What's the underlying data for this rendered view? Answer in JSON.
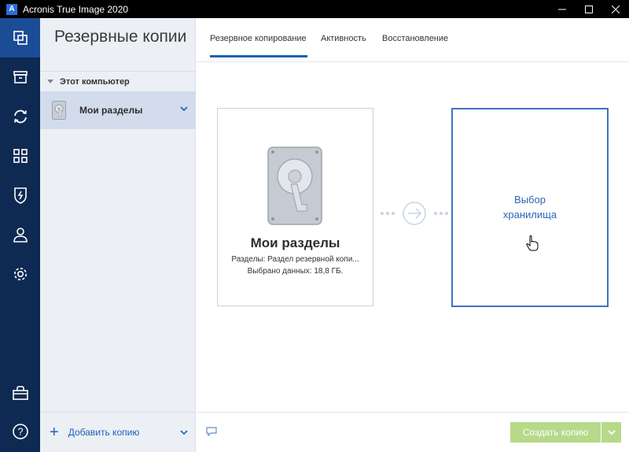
{
  "window": {
    "title": "Acronis True Image 2020",
    "logo_letter": "A"
  },
  "rail": {
    "items": [
      {
        "icon": "backup-copies-icon",
        "active": true
      },
      {
        "icon": "archive-icon",
        "active": false
      },
      {
        "icon": "sync-icon",
        "active": false
      },
      {
        "icon": "tools-grid-icon",
        "active": false
      },
      {
        "icon": "shield-icon",
        "active": false
      },
      {
        "icon": "account-icon",
        "active": false
      },
      {
        "icon": "settings-icon",
        "active": false
      },
      {
        "icon": "store-icon",
        "active": false
      },
      {
        "icon": "help-icon",
        "active": false
      }
    ]
  },
  "sidebar": {
    "title": "Резервные копии",
    "group_label": "Этот компьютер",
    "source_item_label": "Мои разделы",
    "add_label": "Добавить копию"
  },
  "tabs": [
    {
      "label": "Резервное копирование",
      "active": true
    },
    {
      "label": "Активность",
      "active": false
    },
    {
      "label": "Восстановление",
      "active": false
    }
  ],
  "source_card": {
    "title": "Мои разделы",
    "line1": "Разделы: Раздел резервной копи...",
    "line2": "Выбрано данных: 18,8 ГБ."
  },
  "dest_card": {
    "line1": "Выбор",
    "line2": "хранилища"
  },
  "bottom": {
    "create_label": "Создать копию"
  },
  "colors": {
    "rail_bg": "#0e2a52",
    "rail_active": "#1b4c96",
    "accent": "#1f5fb8",
    "create_button": "#b7d98a"
  }
}
